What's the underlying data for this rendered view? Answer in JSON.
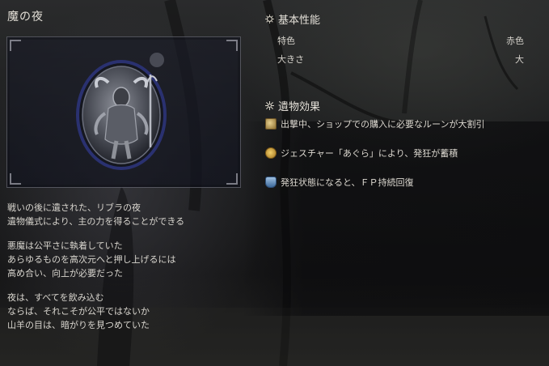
{
  "relic": {
    "name": "魔の夜",
    "description": [
      [
        "戦いの後に遺された、リブラの夜",
        "遺物儀式により、主の力を得ることができる"
      ],
      [
        "悪魔は公平さに執着していた",
        "あらゆるものを高次元へと押し上げるには",
        "高め合い、向上が必要だった"
      ],
      [
        "夜は、すべてを飲み込む",
        "ならば、それこそが公平ではないか",
        "山羊の目は、暗がりを見つめていた"
      ]
    ]
  },
  "basic": {
    "heading": "基本性能",
    "icon": "sun-emblem-icon",
    "rows": [
      {
        "label": "特色",
        "value": "赤色"
      },
      {
        "label": "大きさ",
        "value": "大"
      }
    ]
  },
  "effects": {
    "heading": "遺物効果",
    "icon": "starburst-icon",
    "items": [
      {
        "icon": "shop-bag-icon",
        "text": "出撃中、ショップでの購入に必要なルーンが大割引",
        "color": "#b59a5c"
      },
      {
        "icon": "gesture-icon",
        "text": "ジェスチャー「あぐら」により、発狂が蓄積",
        "color": "#c9a14a"
      },
      {
        "icon": "fp-flask-icon",
        "text": "発狂状態になると、ＦＰ持続回復",
        "color": "#6d90b8"
      }
    ]
  },
  "colors": {
    "accent": "#c9a14a",
    "frame_border": "#9696a0"
  }
}
